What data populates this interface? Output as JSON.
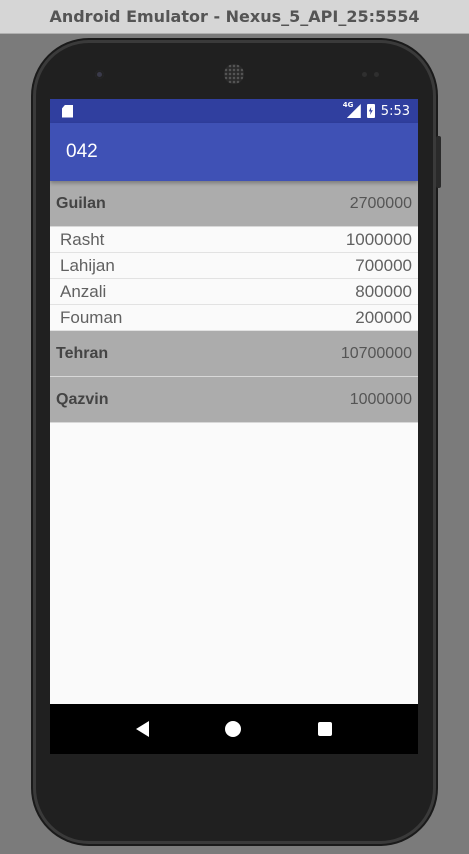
{
  "window": {
    "title": "Android Emulator - Nexus_5_API_25:5554"
  },
  "statusbar": {
    "network": "4G",
    "time": "5:53"
  },
  "appbar": {
    "title": "042"
  },
  "groups": [
    {
      "name": "Guilan",
      "total": "2700000",
      "children": [
        {
          "name": "Rasht",
          "value": "1000000"
        },
        {
          "name": "Lahijan",
          "value": "700000"
        },
        {
          "name": "Anzali",
          "value": "800000"
        },
        {
          "name": "Fouman",
          "value": "200000"
        }
      ]
    },
    {
      "name": "Tehran",
      "total": "10700000",
      "children": []
    },
    {
      "name": "Qazvin",
      "total": "1000000",
      "children": []
    }
  ],
  "navbar": {
    "icons": [
      "back-icon",
      "home-icon",
      "recents-icon"
    ]
  }
}
